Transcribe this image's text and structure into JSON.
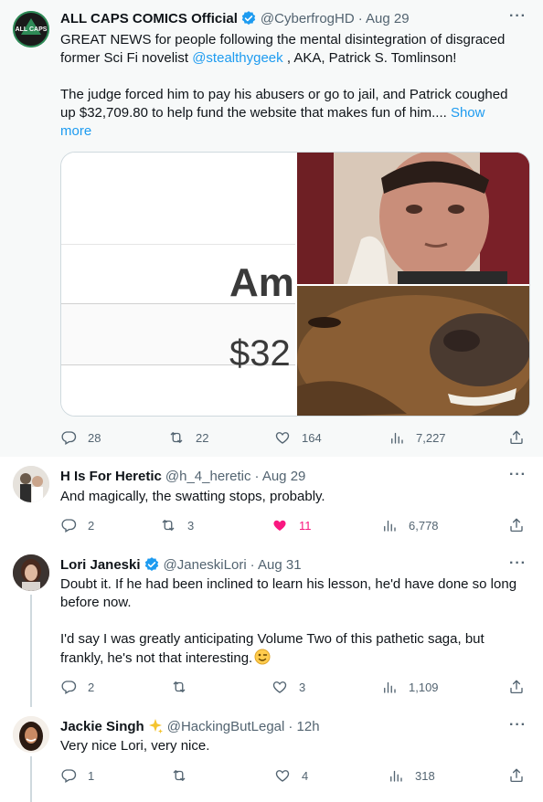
{
  "main": {
    "avatar_text": "ALL CAPS",
    "name": "ALL CAPS COMICS Official",
    "handle": "@CyberfrogHD",
    "time": "· Aug 29",
    "text_line1": "GREAT NEWS for people following the mental disintegration of disgraced",
    "text_line2_pre": "former Sci Fi novelist ",
    "mention": "@stealthygeek",
    "text_line2_post": " , AKA, Patrick S. Tomlinson!",
    "text_line3": "The judge forced him to pay his abusers or go to jail, and Patrick coughed",
    "text_line4": "up $32,709.80 to help fund the website that makes fun of him....",
    "show_more_1": " Show",
    "show_more_2": "more",
    "media_text_1": "Am",
    "media_text_2": "$32",
    "replies": "28",
    "retweets": "22",
    "likes": "164",
    "views": "7,227"
  },
  "reply1": {
    "name": "H Is For Heretic",
    "handle": "@h_4_heretic",
    "time": "· Aug 29",
    "text": "And magically, the swatting stops, probably.",
    "replies": "2",
    "retweets": "3",
    "likes": "11",
    "views": "6,778"
  },
  "reply2": {
    "name": "Lori Janeski",
    "handle": "@JaneskiLori",
    "time": "· Aug 31",
    "text_line1": "Doubt it.  If he had been inclined to learn his lesson, he'd have done so long",
    "text_line2": "before now.",
    "text_line3": "I'd say I was greatly anticipating Volume Two of this pathetic saga, but",
    "text_line4": "frankly, he's not that interesting.",
    "replies": "2",
    "retweets": "",
    "likes": "3",
    "views": "1,109"
  },
  "reply3": {
    "name": "Jackie Singh",
    "handle": "@HackingButLegal",
    "time": "· 12h",
    "text": "Very nice Lori, very nice.",
    "replies": "1",
    "retweets": "",
    "likes": "4",
    "views": "318"
  },
  "more_glyph": "···",
  "colors": {
    "accent": "#1d9bf0",
    "like": "#f91880",
    "muted": "#536471"
  }
}
